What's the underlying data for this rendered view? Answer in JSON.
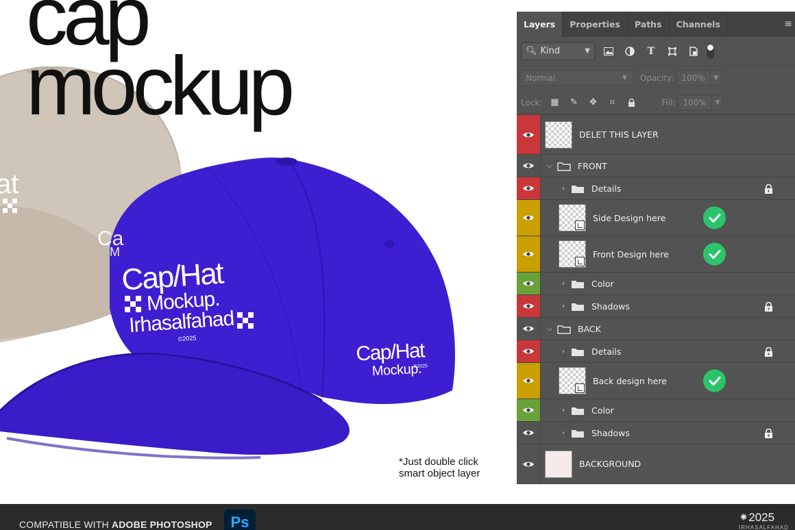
{
  "hero": {
    "title_line1": "cap",
    "title_line2": "mockup",
    "hint_line1": "*Just double click",
    "hint_line2": "smart object layer"
  },
  "cap_front_print": {
    "line1": "Cap/Hat",
    "line2": "Mockup.",
    "line3": "Irhasalfahad",
    "year": "©2025"
  },
  "cap_side_print": {
    "line1": "Cap/Hat",
    "line2": "Mockup.",
    "year": "©2025"
  },
  "back_cap_print": {
    "fragment1": "at",
    "fragment2": "Ca",
    "fragment3": "M"
  },
  "colors": {
    "blue_cap": "#3d1fd1",
    "beige_cap": "#cfc5b8",
    "eye_red": "#c8373a",
    "eye_yellow": "#c9a000",
    "eye_green": "#6aa13a",
    "check_green": "#2bc46b"
  },
  "panel": {
    "tabs": [
      "Layers",
      "Properties",
      "Paths",
      "Channels"
    ],
    "menu_icon": "panel-menu-icon",
    "kind_label": "Kind",
    "blend_mode": "Normal",
    "opacity_label": "Opacity:",
    "opacity_value": "100%",
    "lock_label": "Lock:",
    "fill_label": "Fill:",
    "fill_value": "100%",
    "layers": [
      {
        "name": "DELET THIS LAYER",
        "type": "layer",
        "eye": "red",
        "depth": 0,
        "thumb": "transparent"
      },
      {
        "name": "FRONT",
        "type": "group-open",
        "eye": "none",
        "depth": 0
      },
      {
        "name": "Details",
        "type": "group-closed",
        "eye": "red",
        "depth": 1,
        "locked": true
      },
      {
        "name": "Side Design here",
        "type": "smart-object",
        "eye": "yellow",
        "depth": 1,
        "checked": true
      },
      {
        "name": "Front Design here",
        "type": "smart-object",
        "eye": "yellow",
        "depth": 1,
        "checked": true
      },
      {
        "name": "Color",
        "type": "group-closed",
        "eye": "green",
        "depth": 1
      },
      {
        "name": "Shadows",
        "type": "group-closed",
        "eye": "red",
        "depth": 1,
        "locked": true
      },
      {
        "name": "BACK",
        "type": "group-open",
        "eye": "none",
        "depth": 0
      },
      {
        "name": "Details",
        "type": "group-closed",
        "eye": "red",
        "depth": 1,
        "locked": true
      },
      {
        "name": "Back design here",
        "type": "smart-object",
        "eye": "yellow",
        "depth": 1,
        "checked": true
      },
      {
        "name": "Color",
        "type": "group-closed",
        "eye": "green",
        "depth": 1
      },
      {
        "name": "Shadows",
        "type": "group-closed",
        "eye": "none",
        "depth": 1,
        "locked": true
      },
      {
        "name": "BACKGROUND",
        "type": "layer",
        "eye": "none",
        "depth": 0,
        "thumb": "plain"
      }
    ]
  },
  "footer": {
    "compat_prefix": "COMPATIBLE WITH",
    "compat_app": "ADOBE PHOTOSHOP",
    "app_badge": "Ps",
    "year": "⁕2025",
    "author": "IRHASALFAHAD"
  }
}
